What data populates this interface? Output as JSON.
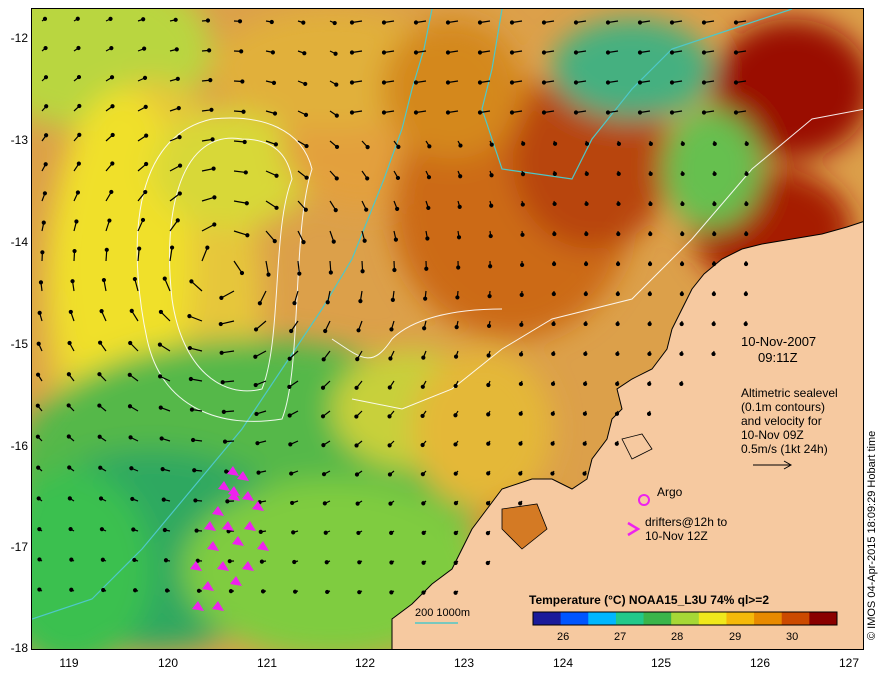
{
  "map": {
    "lon_ticks": [
      "119",
      "120",
      "121",
      "122",
      "123",
      "124",
      "125",
      "126",
      "127"
    ],
    "lat_ticks": [
      "-12",
      "-13",
      "-14",
      "-15",
      "-16",
      "-17",
      "-18"
    ]
  },
  "annotations": {
    "date": "10-Nov-2007",
    "time": "09:11Z",
    "altimetric_lines": [
      "Altimetric sealevel",
      "(0.1m contours)",
      "and velocity for",
      "10-Nov 09Z",
      "0.5m/s (1kt 24h)"
    ],
    "argo_label": "Argo",
    "drifters_line1": "drifters@12h to",
    "drifters_line2": "10-Nov 12Z",
    "bathymetry_label": "200  1000m"
  },
  "colorbar": {
    "title": "Temperature (°C) NOAA15_L3U 74% ql>=2",
    "ticks": [
      "26",
      "27",
      "28",
      "29",
      "30"
    ],
    "colors": [
      "#1a1a9a",
      "#0055ff",
      "#00b7ff",
      "#22c98a",
      "#3ab54a",
      "#a6d836",
      "#f0e81c",
      "#f5b90a",
      "#e88a00",
      "#cc4a00",
      "#8a0000"
    ]
  },
  "credit": "© IMOS 04-Apr-2015 18:09:29 Hobart time",
  "colors": {
    "land": "#f6c9a0",
    "warm_sst": "#e0a040",
    "cool_sst": "#9fd640",
    "contour": "#ffffff",
    "bathymetry": "#4ec8c8",
    "drifter": "#ee22ee"
  }
}
